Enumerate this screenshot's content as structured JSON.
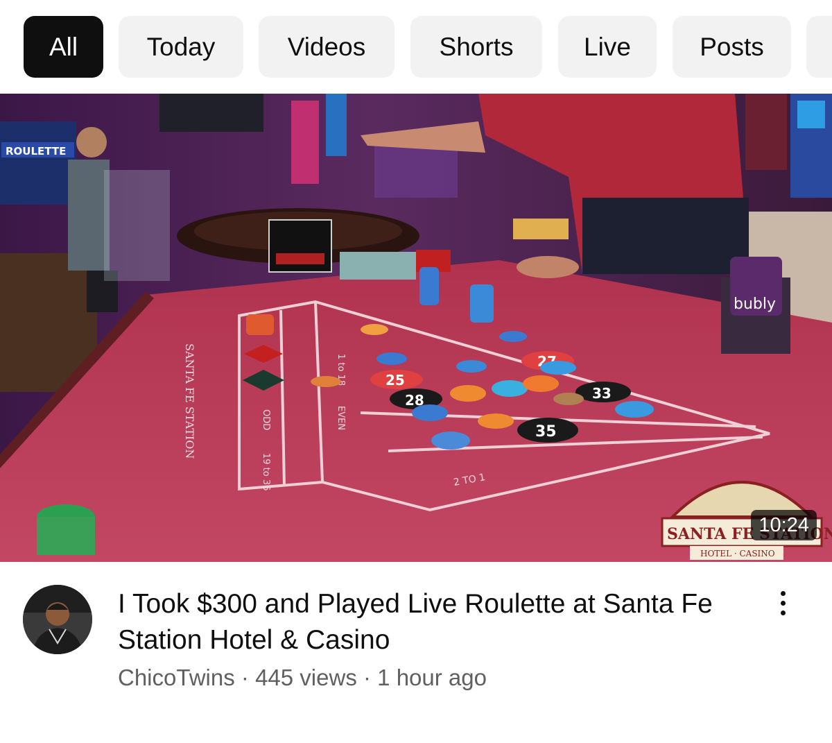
{
  "filters": {
    "chips": [
      "All",
      "Today",
      "Videos",
      "Shorts",
      "Live",
      "Posts"
    ],
    "active_index": 0
  },
  "video": {
    "thumbnail_icon": "video-thumbnail-roulette",
    "duration": "10:24",
    "title": "I Took $300 and Played Live Roulette at Santa Fe Station Hotel & Casino",
    "channel": "ChicoTwins",
    "views": "445 views",
    "age": "1 hour ago",
    "separator": "·",
    "avatar_icon": "channel-avatar",
    "menu_icon": "more-vert-icon"
  },
  "thumbnail_text": {
    "sign_left": "ROULETTE",
    "table_brand": "SANTA FE STATION",
    "logo_main": "SANTA FE STATION",
    "logo_sub": "HOTEL · CASINO",
    "can_brand": "bubly",
    "num_25": "25",
    "num_27": "27",
    "num_28": "28",
    "num_33": "33",
    "num_35": "35",
    "two_to_one": "2 TO 1",
    "low": "1 to 18",
    "high": "19 to 36",
    "odd": "ODD",
    "even": "EVEN"
  },
  "colors": {
    "chip_bg": "#f2f2f2",
    "chip_active_bg": "#0f0f0f",
    "title": "#0f0f0f",
    "meta": "#606060",
    "felt": "#b53a56"
  }
}
